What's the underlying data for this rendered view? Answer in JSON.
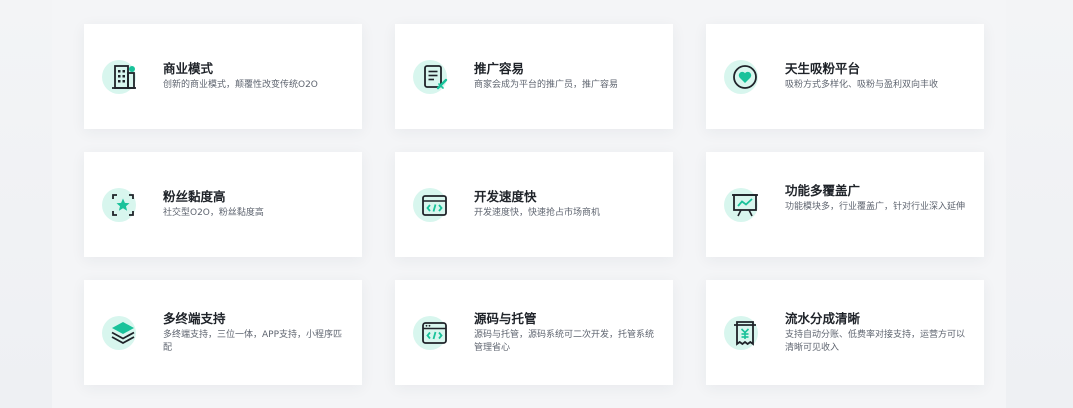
{
  "colors": {
    "accent": "#19c29a",
    "accent_light": "#d8f6ee",
    "ink": "#1f2329"
  },
  "features": [
    {
      "title": "商业模式",
      "desc": "创新的商业模式，颠覆性改变传统O2O",
      "icon": "building-icon"
    },
    {
      "title": "推广容易",
      "desc": "商家会成为平台的推广员，推广容易",
      "icon": "document-edit-icon"
    },
    {
      "title": "天生吸粉平台",
      "desc": "吸粉方式多样化、吸粉与盈利双向丰收",
      "icon": "heart-icon"
    },
    {
      "title": "粉丝黏度高",
      "desc": "社交型O2O，粉丝黏度高",
      "icon": "star-frame-icon"
    },
    {
      "title": "开发速度快",
      "desc": "开发速度快，快速抢占市场商机",
      "icon": "code-window-icon"
    },
    {
      "title": "功能多覆盖广",
      "desc": "功能模块多，行业覆盖广，针对行业深入延伸",
      "icon": "presentation-chart-icon"
    },
    {
      "title": "多终端支持",
      "desc": "多终端支持，三位一体，APP支持，小程序匹配",
      "icon": "layers-icon"
    },
    {
      "title": "源码与托管",
      "desc": "源码与托管，源码系统可二次开发，托管系统管理省心",
      "icon": "code-browser-icon"
    },
    {
      "title": "流水分成清晰",
      "desc": "支持自动分账、低费率对接支持，运营方可以清晰可见收入",
      "icon": "receipt-icon"
    }
  ]
}
